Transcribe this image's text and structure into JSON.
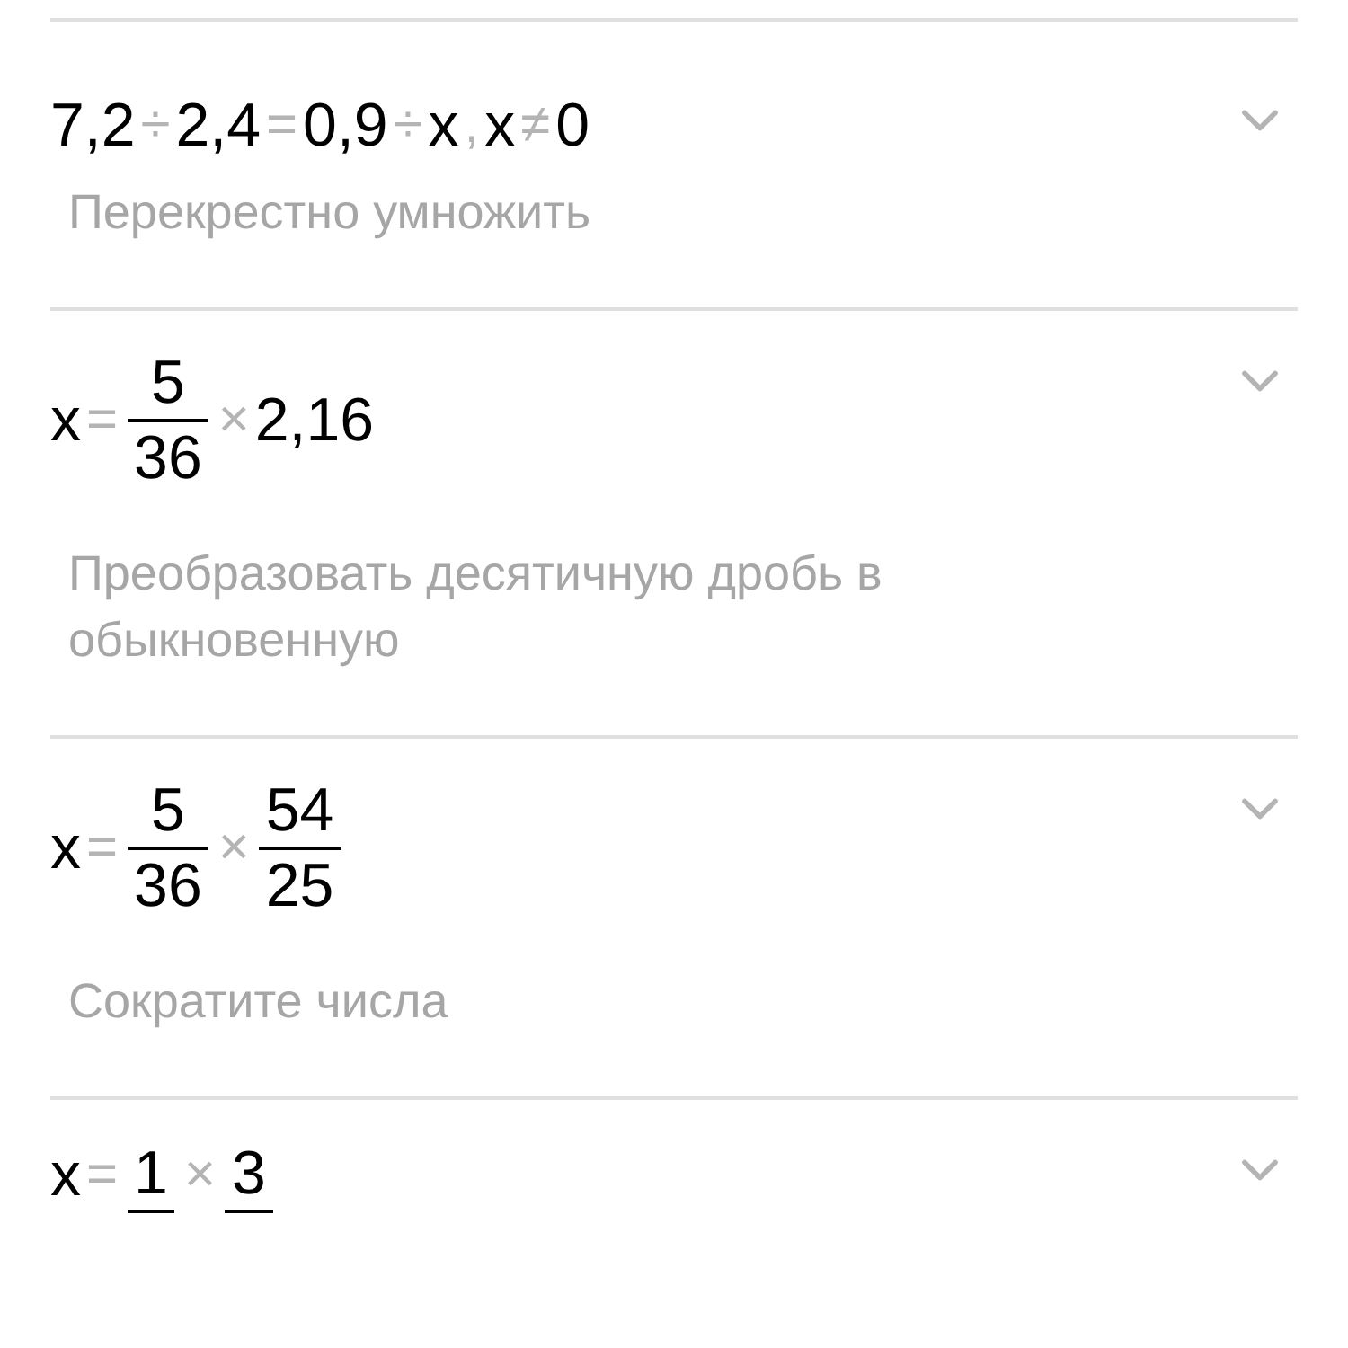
{
  "steps": [
    {
      "expression": [
        {
          "kind": "text",
          "text": "7,2"
        },
        {
          "kind": "op",
          "text": "÷"
        },
        {
          "kind": "text",
          "text": "2,4"
        },
        {
          "kind": "op",
          "text": "="
        },
        {
          "kind": "text",
          "text": "0,9"
        },
        {
          "kind": "op",
          "text": "÷"
        },
        {
          "kind": "text",
          "text": "x"
        },
        {
          "kind": "op",
          "text": ","
        },
        {
          "kind": "text",
          "text": "x"
        },
        {
          "kind": "op",
          "text": "≠"
        },
        {
          "kind": "text",
          "text": "0"
        }
      ],
      "hint": "Перекрестно умножить",
      "expanded": false
    },
    {
      "expression": [
        {
          "kind": "text",
          "text": "x"
        },
        {
          "kind": "op",
          "text": "="
        },
        {
          "kind": "frac",
          "num": "5",
          "den": "36"
        },
        {
          "kind": "op",
          "text": "×"
        },
        {
          "kind": "text",
          "text": "2,16"
        }
      ],
      "hint": "Преобразовать десятичную дробь в обыкновенную",
      "expanded": false
    },
    {
      "expression": [
        {
          "kind": "text",
          "text": "x"
        },
        {
          "kind": "op",
          "text": "="
        },
        {
          "kind": "frac",
          "num": "5",
          "den": "36"
        },
        {
          "kind": "op",
          "text": "×"
        },
        {
          "kind": "frac",
          "num": "54",
          "den": "25"
        }
      ],
      "hint": "Сократите числа",
      "expanded": false
    },
    {
      "expression": [
        {
          "kind": "text",
          "text": "x"
        },
        {
          "kind": "op",
          "text": "="
        },
        {
          "kind": "frac",
          "num": "1"
        },
        {
          "kind": "op",
          "text": "×"
        },
        {
          "kind": "frac",
          "num": "3"
        }
      ],
      "expanded": false
    }
  ]
}
